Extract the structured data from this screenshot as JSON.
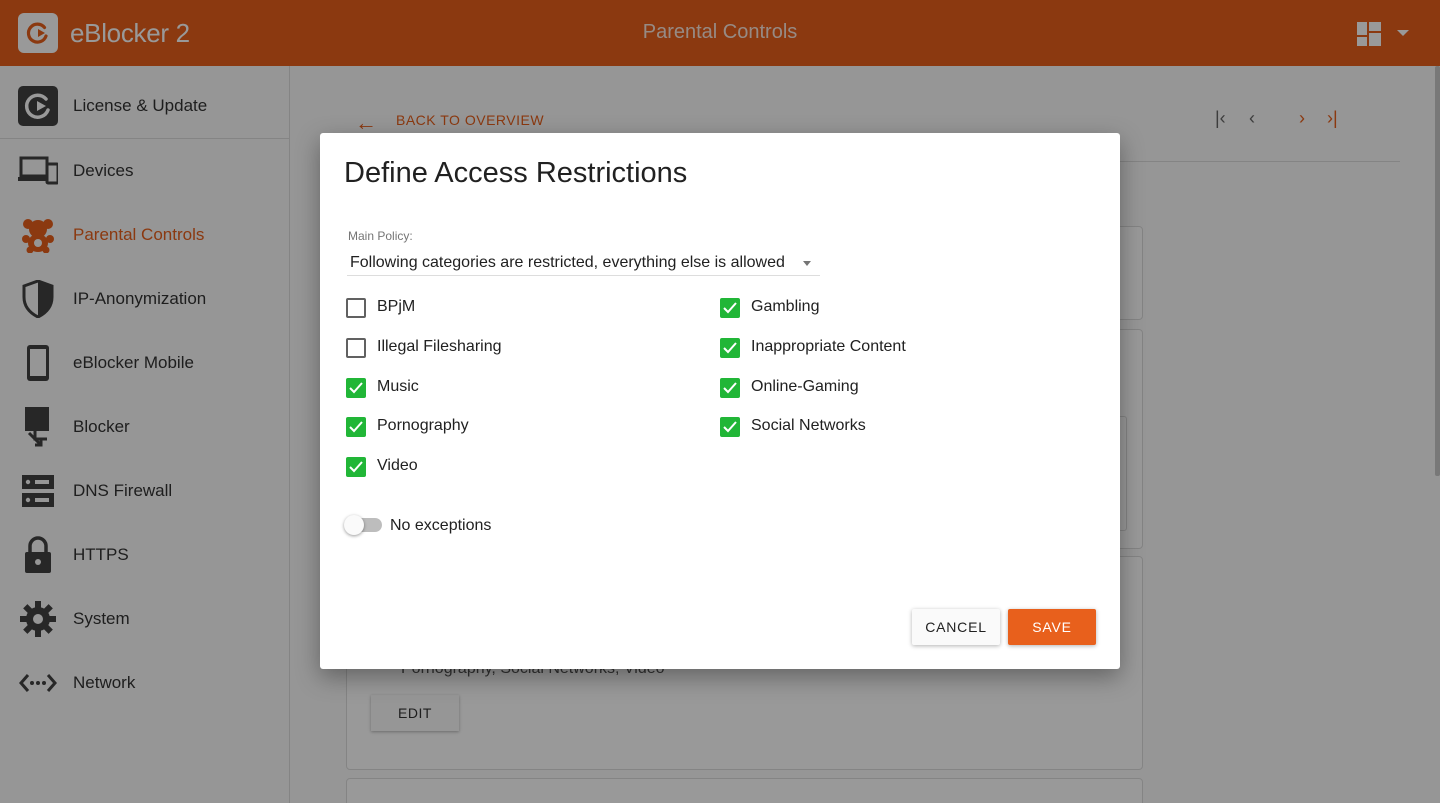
{
  "header": {
    "brand": "eBlocker 2",
    "title": "Parental Controls",
    "logo_icon": "eblocker-logo-icon",
    "dashboard_icon": "dashboard-icon",
    "menu_icon": "caret-down-icon"
  },
  "sidebar": {
    "items": [
      {
        "label": "License & Update",
        "icon": "eblocker-logo-icon",
        "active": false
      },
      {
        "label": "Devices",
        "icon": "devices-icon",
        "active": false
      },
      {
        "label": "Parental Controls",
        "icon": "teddy-bear-icon",
        "active": true
      },
      {
        "label": "IP-Anonymization",
        "icon": "shield-icon",
        "active": false
      },
      {
        "label": "eBlocker Mobile",
        "icon": "phone-icon",
        "active": false
      },
      {
        "label": "Blocker",
        "icon": "blocker-icon",
        "active": false
      },
      {
        "label": "DNS Firewall",
        "icon": "server-icon",
        "active": false
      },
      {
        "label": "HTTPS",
        "icon": "lock-icon",
        "active": false
      },
      {
        "label": "System",
        "icon": "gear-icon",
        "active": false
      },
      {
        "label": "Network",
        "icon": "network-icon",
        "active": false
      }
    ]
  },
  "main": {
    "back_label": "BACK TO OVERVIEW",
    "background_text": "Pornography,  Social Networks,  Video",
    "edit_label": "EDIT"
  },
  "dialog": {
    "title": "Define Access Restrictions",
    "policy_label": "Main Policy:",
    "policy_value": "Following categories are restricted, everything else is allowed",
    "categories_left": [
      {
        "label": "BPjM",
        "checked": false
      },
      {
        "label": "Illegal Filesharing",
        "checked": false
      },
      {
        "label": "Music",
        "checked": true
      },
      {
        "label": "Pornography",
        "checked": true
      },
      {
        "label": "Video",
        "checked": true
      }
    ],
    "categories_right": [
      {
        "label": "Gambling",
        "checked": true
      },
      {
        "label": "Inappropriate Content",
        "checked": true
      },
      {
        "label": "Online-Gaming",
        "checked": true
      },
      {
        "label": "Social Networks",
        "checked": true
      }
    ],
    "exceptions_label": "No exceptions",
    "exceptions_enabled": false,
    "cancel_label": "CANCEL",
    "save_label": "SAVE"
  },
  "colors": {
    "accent": "#e8601c",
    "checkbox_checked": "#21b637"
  }
}
